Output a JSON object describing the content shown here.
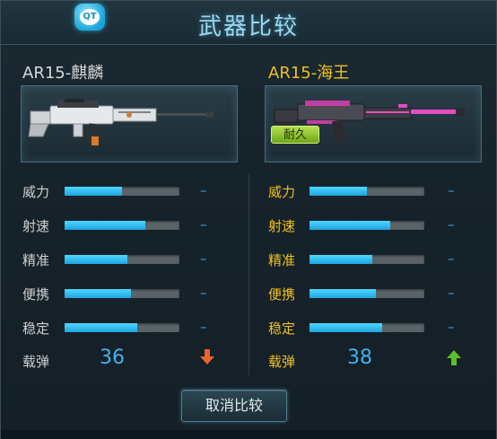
{
  "window": {
    "title": "武器比较",
    "logo_text": "QT"
  },
  "left": {
    "name": "AR15-麒麟",
    "stats": [
      {
        "label": "威力",
        "value": 0.5,
        "diff": "–"
      },
      {
        "label": "射速",
        "value": 0.7,
        "diff": "–"
      },
      {
        "label": "精准",
        "value": 0.55,
        "diff": "–"
      },
      {
        "label": "便携",
        "value": 0.58,
        "diff": "–"
      },
      {
        "label": "稳定",
        "value": 0.63,
        "diff": "–"
      }
    ],
    "ammo_label": "载弹",
    "ammo_value": "36",
    "ammo_trend": "down",
    "ammo_trend_color": "#e8642a"
  },
  "right": {
    "name": "AR15-海王",
    "badge": "耐久",
    "stats": [
      {
        "label": "威力",
        "value": 0.5,
        "diff": "–"
      },
      {
        "label": "射速",
        "value": 0.7,
        "diff": "–"
      },
      {
        "label": "精准",
        "value": 0.55,
        "diff": "–"
      },
      {
        "label": "便携",
        "value": 0.58,
        "diff": "–"
      },
      {
        "label": "稳定",
        "value": 0.63,
        "diff": "–"
      }
    ],
    "ammo_label": "载弹",
    "ammo_value": "38",
    "ammo_trend": "up",
    "ammo_trend_color": "#5cbf2a"
  },
  "cancel_button": "取消比较",
  "colors": {
    "accent_blue": "#29a9e8",
    "title_blue": "#9bd8ee",
    "gold": "#f0c020",
    "bar_track": "#5a6368"
  },
  "icons": {
    "logo": "qt-logo-icon",
    "down": "arrow-down-icon",
    "up": "arrow-up-icon"
  }
}
